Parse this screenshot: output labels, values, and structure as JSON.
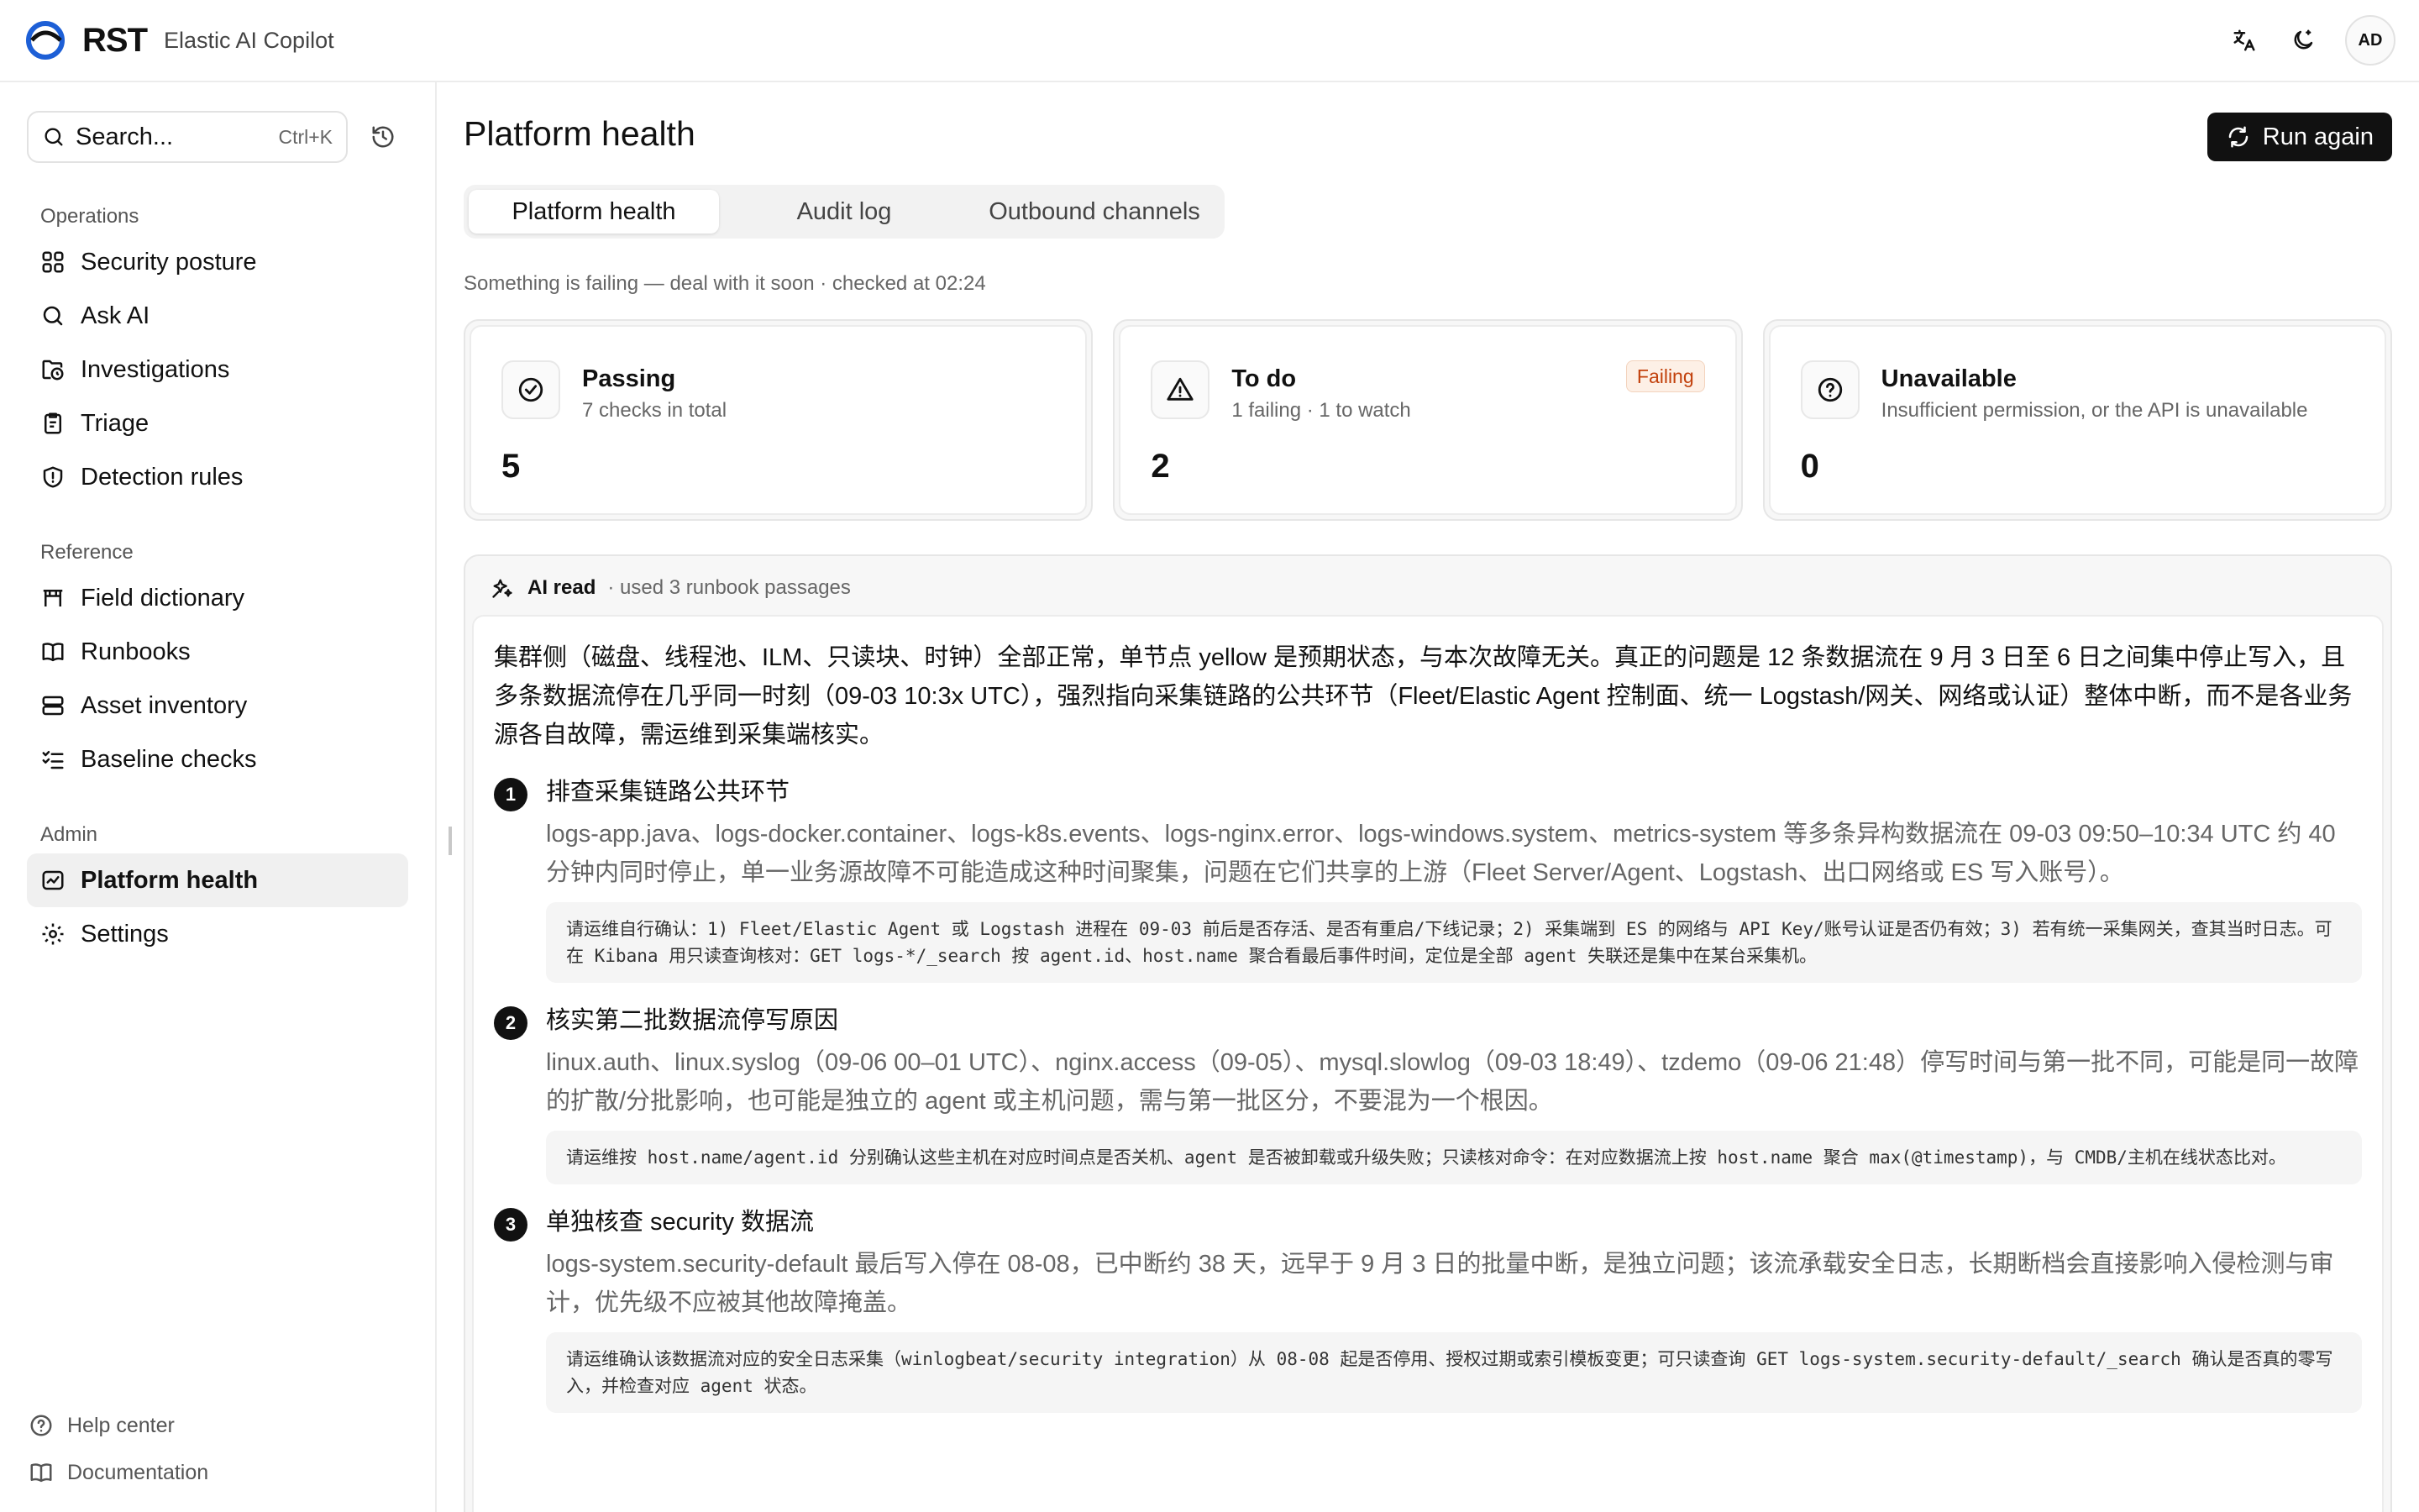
{
  "header": {
    "logo_text": "RST",
    "app_name": "Elastic AI Copilot",
    "user_initials": "AD",
    "icons": {
      "translate": "translate-icon",
      "theme": "moon-icon"
    }
  },
  "sidebar": {
    "search": {
      "placeholder": "Search...",
      "shortcut": "Ctrl+K"
    },
    "sections": [
      {
        "label": "Operations",
        "items": [
          {
            "label": "Security posture",
            "icon": "grid-icon"
          },
          {
            "label": "Ask AI",
            "icon": "search-icon"
          },
          {
            "label": "Investigations",
            "icon": "folder-clock-icon"
          },
          {
            "label": "Triage",
            "icon": "clipboard-icon"
          },
          {
            "label": "Detection rules",
            "icon": "shield-alert-icon"
          }
        ]
      },
      {
        "label": "Reference",
        "items": [
          {
            "label": "Field dictionary",
            "icon": "table-icon"
          },
          {
            "label": "Runbooks",
            "icon": "book-icon"
          },
          {
            "label": "Asset inventory",
            "icon": "server-icon"
          },
          {
            "label": "Baseline checks",
            "icon": "list-checks-icon"
          }
        ]
      },
      {
        "label": "Admin",
        "items": [
          {
            "label": "Platform health",
            "icon": "activity-icon",
            "active": true
          },
          {
            "label": "Settings",
            "icon": "gear-icon"
          }
        ]
      }
    ],
    "footer": [
      {
        "label": "Help center",
        "icon": "help-icon"
      },
      {
        "label": "Documentation",
        "icon": "book-open-icon"
      }
    ]
  },
  "main": {
    "title": "Platform health",
    "run_button": "Run again",
    "tabs": [
      {
        "label": "Platform health",
        "active": true
      },
      {
        "label": "Audit log"
      },
      {
        "label": "Outbound channels"
      }
    ],
    "status_line": "Something is failing — deal with it soon · checked at 02:24",
    "cards": [
      {
        "title": "Passing",
        "subtitle": "7 checks in total",
        "value": "5",
        "icon": "check-circle-icon"
      },
      {
        "title": "To do",
        "subtitle": "1 failing · 1 to watch",
        "value": "2",
        "badge": "Failing",
        "icon": "warning-triangle-icon"
      },
      {
        "title": "Unavailable",
        "subtitle": "Insufficient permission, or the API is unavailable",
        "value": "0",
        "icon": "help-circle-icon"
      }
    ],
    "ai": {
      "title": "AI read",
      "subtitle": "· used 3 runbook passages",
      "summary": "集群侧（磁盘、线程池、ILM、只读块、时钟）全部正常，单节点 yellow 是预期状态，与本次故障无关。真正的问题是 12 条数据流在 9 月 3 日至 6 日之间集中停止写入，且多条数据流停在几乎同一时刻（09-03 10:3x UTC），强烈指向采集链路的公共环节（Fleet/Elastic Agent 控制面、统一 Logstash/网关、网络或认证）整体中断，而不是各业务源各自故障，需运维到采集端核实。",
      "steps": [
        {
          "num": "1",
          "title": "排查采集链路公共环节",
          "desc": "logs-app.java、logs-docker.container、logs-k8s.events、logs-nginx.error、logs-windows.system、metrics-system 等多条异构数据流在 09-03 09:50–10:34 UTC 约 40 分钟内同时停止，单一业务源故障不可能造成这种时间聚集，问题在它们共享的上游（Fleet Server/Agent、Logstash、出口网络或 ES 写入账号）。",
          "cmd": "请运维自行确认：1) Fleet/Elastic Agent 或 Logstash 进程在 09-03 前后是否存活、是否有重启/下线记录；2) 采集端到 ES 的网络与 API Key/账号认证是否仍有效；3) 若有统一采集网关，查其当时日志。可在 Kibana 用只读查询核对：GET logs-*/_search 按 agent.id、host.name 聚合看最后事件时间，定位是全部 agent 失联还是集中在某台采集机。"
        },
        {
          "num": "2",
          "title": "核实第二批数据流停写原因",
          "desc": "linux.auth、linux.syslog（09-06 00–01 UTC）、nginx.access（09-05）、mysql.slowlog（09-03 18:49）、tzdemo（09-06 21:48）停写时间与第一批不同，可能是同一故障的扩散/分批影响，也可能是独立的 agent 或主机问题，需与第一批区分，不要混为一个根因。",
          "cmd": "请运维按 host.name/agent.id 分别确认这些主机在对应时间点是否关机、agent 是否被卸载或升级失败；只读核对命令：在对应数据流上按 host.name 聚合 max(@timestamp)，与 CMDB/主机在线状态比对。"
        },
        {
          "num": "3",
          "title": "单独核查 security 数据流",
          "desc": "logs-system.security-default 最后写入停在 08-08，已中断约 38 天，远早于 9 月 3 日的批量中断，是独立问题；该流承载安全日志，长期断档会直接影响入侵检测与审计，优先级不应被其他故障掩盖。",
          "cmd": "请运维确认该数据流对应的安全日志采集（winlogbeat/security integration）从 08-08 起是否停用、授权过期或索引模板变更；可只读查询 GET logs-system.security-default/_search 确认是否真的零写入，并检查对应 agent 状态。"
        }
      ]
    }
  },
  "colors": {
    "accent": "#111111",
    "brand_blue": "#1d5fd6",
    "badge_text": "#c2410c",
    "badge_bg": "#fdf0e6"
  }
}
